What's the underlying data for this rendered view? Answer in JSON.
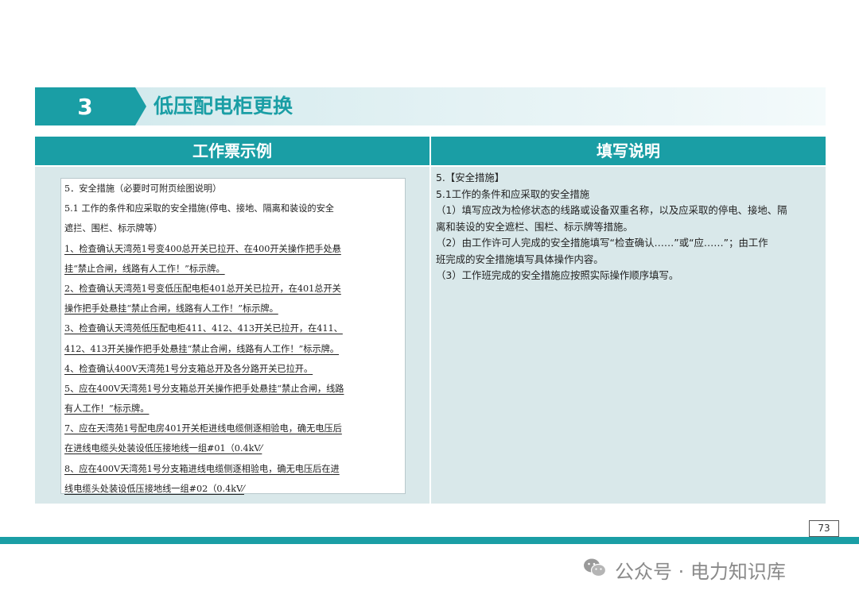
{
  "section": {
    "number": "3",
    "title": "低压配电柜更换"
  },
  "table": {
    "header_left": "工作票示例",
    "header_right": "填写说明"
  },
  "ticket_lines": [
    "5．安全措施（必要时可附页绘图说明）",
    "5.1 工作的条件和应采取的安全措施(停电、接地、隔离和装设的安全",
    "遮拦、围栏、标示牌等）",
    "1、检查确认天湾苑1号变400总开关已拉开、在400开关操作把手处悬",
    "挂“禁止合闸，线路有人工作！”标示牌。",
    "2、检查确认天湾苑1号变低压配电柜401总开关已拉开，在401总开关",
    "操作把手处悬挂“禁止合闸，线路有人工作！”标示牌。",
    "3、检查确认天湾苑低压配电柜411、412、413开关已拉开，在411、",
    "412、413开关操作把手处悬挂“禁止合闸，线路有人工作！”标示牌。",
    "4、检查确认400V天湾苑1号分支箱总开及各分路开关已拉开。",
    "5、应在400V天湾苑1号分支箱总开关操作把手处悬挂“禁止合闸，线路",
    "有人工作！”标示牌。",
    "7、应在天湾苑1号配电房401开关柜进线电缆侧逐相验电，确无电压后",
    "在进线电缆头处装设低压接地线一组#01（0.4kV⁄",
    "8、应在400V天湾苑1号分支箱进线电缆侧逐相验电，确无电压后在进",
    "线电缆头处装设低压接地线一组#02（0.4kV⁄"
  ],
  "guide_lines": [
    "5.【安全措施】",
    "5.1工作的条件和应采取的安全措施",
    "（1）填写应改为检修状态的线路或设备双重名称，以及应采取的停电、接地、隔",
    "离和装设的安全遮栏、围栏、标示牌等措施。",
    "（2）由工作许可人完成的安全措施填写“检查确认……”或“应……”；由工作",
    "班完成的安全措施填写具体操作内容。",
    "（3）工作班完成的安全措施应按照实际操作顺序填写。"
  ],
  "footer": {
    "page_number": "73",
    "watermark": "公众号 · 电力知识库"
  },
  "colors": {
    "accent": "#1a9ea5",
    "cell_bg": "#d9e8ea"
  },
  "icons": {
    "watermark": "wechat-icon"
  }
}
